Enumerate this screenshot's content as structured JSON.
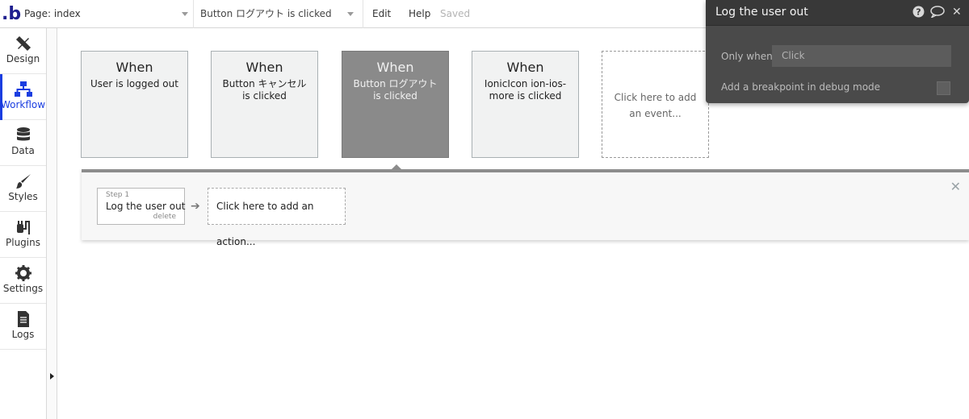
{
  "topbar": {
    "logo": ".b",
    "page_label": "Page: index",
    "event_label": "Button ログアウト is clicked",
    "edit": "Edit",
    "help": "Help",
    "saved": "Saved"
  },
  "sidebar": {
    "items": [
      {
        "label": "Design",
        "icon": "design-icon",
        "active": false
      },
      {
        "label": "Workflow",
        "icon": "workflow-icon",
        "active": true
      },
      {
        "label": "Data",
        "icon": "database-icon",
        "active": false
      },
      {
        "label": "Styles",
        "icon": "brush-icon",
        "active": false
      },
      {
        "label": "Plugins",
        "icon": "plug-icon",
        "active": false
      },
      {
        "label": "Settings",
        "icon": "gear-icon",
        "active": false
      },
      {
        "label": "Logs",
        "icon": "document-icon",
        "active": false
      }
    ]
  },
  "events": [
    {
      "when": "When",
      "desc": "User is logged out",
      "selected": false
    },
    {
      "when": "When",
      "desc": "Button キャンセル is clicked",
      "selected": false
    },
    {
      "when": "When",
      "desc": "Button ログアウト is clicked",
      "selected": true
    },
    {
      "when": "When",
      "desc": "IonicIcon ion-ios-more is clicked",
      "selected": false
    }
  ],
  "add_event": "Click here to add an event...",
  "actions": {
    "step_number": "Step 1",
    "step_name": "Log the user out",
    "delete_label": "delete",
    "add_action": "Click here to add an action...",
    "close_icon": "close-icon"
  },
  "property_editor": {
    "title": "Log the user out",
    "only_when_label": "Only when",
    "only_when_placeholder": "Click",
    "breakpoint_label": "Add a breakpoint in debug mode",
    "icons": [
      "help-icon",
      "comment-icon",
      "close-icon"
    ]
  },
  "colors": {
    "accent": "#1a3de0",
    "selected_card": "#8a8a8a",
    "panel_dark": "#4a4a4a"
  }
}
